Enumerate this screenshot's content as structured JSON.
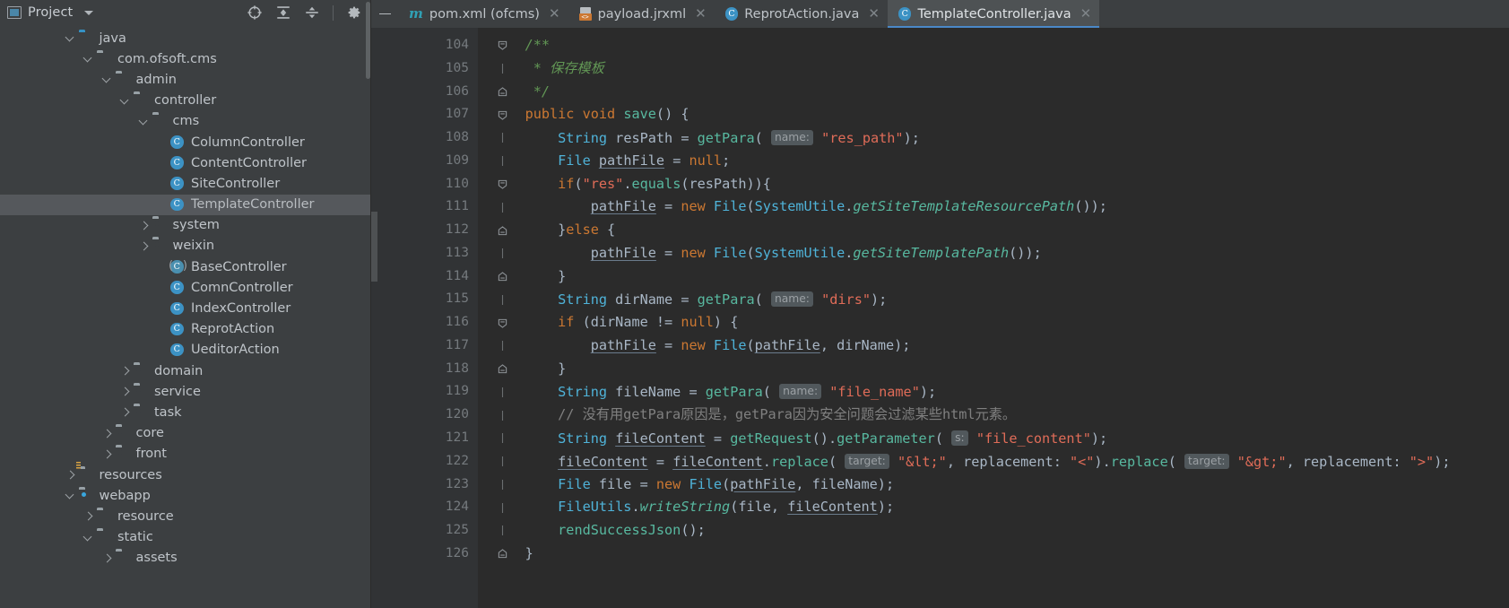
{
  "sidebar": {
    "title": "Project",
    "icons": [
      "project-icon",
      "chevron-down-icon",
      "locate-icon",
      "expand-all-icon",
      "collapse-all-icon",
      "gear-icon"
    ],
    "tree": [
      {
        "label": "java",
        "indent": 3,
        "twisty": "down",
        "icon": "folder-source-blue",
        "selected": false
      },
      {
        "label": "com.ofsoft.cms",
        "indent": 4,
        "twisty": "down",
        "icon": "folder-package",
        "selected": false
      },
      {
        "label": "admin",
        "indent": 5,
        "twisty": "down",
        "icon": "folder-package",
        "selected": false
      },
      {
        "label": "controller",
        "indent": 6,
        "twisty": "down",
        "icon": "folder-package",
        "selected": false
      },
      {
        "label": "cms",
        "indent": 7,
        "twisty": "down",
        "icon": "folder-package",
        "selected": false
      },
      {
        "label": "ColumnController",
        "indent": 8,
        "twisty": "none",
        "icon": "class-icon",
        "selected": false
      },
      {
        "label": "ContentController",
        "indent": 8,
        "twisty": "none",
        "icon": "class-icon",
        "selected": false
      },
      {
        "label": "SiteController",
        "indent": 8,
        "twisty": "none",
        "icon": "class-icon",
        "selected": false
      },
      {
        "label": "TemplateController",
        "indent": 8,
        "twisty": "none",
        "icon": "class-icon",
        "selected": true
      },
      {
        "label": "system",
        "indent": 7,
        "twisty": "right",
        "icon": "folder-package",
        "selected": false
      },
      {
        "label": "weixin",
        "indent": 7,
        "twisty": "right",
        "icon": "folder-package",
        "selected": false
      },
      {
        "label": "BaseController",
        "indent": 8,
        "twisty": "none",
        "icon": "abstract-class-icon",
        "selected": false
      },
      {
        "label": "ComnController",
        "indent": 8,
        "twisty": "none",
        "icon": "class-icon",
        "selected": false
      },
      {
        "label": "IndexController",
        "indent": 8,
        "twisty": "none",
        "icon": "class-icon",
        "selected": false
      },
      {
        "label": "ReprotAction",
        "indent": 8,
        "twisty": "none",
        "icon": "class-icon",
        "selected": false
      },
      {
        "label": "UeditorAction",
        "indent": 8,
        "twisty": "none",
        "icon": "class-icon",
        "selected": false
      },
      {
        "label": "domain",
        "indent": 6,
        "twisty": "right",
        "icon": "folder-package",
        "selected": false
      },
      {
        "label": "service",
        "indent": 6,
        "twisty": "right",
        "icon": "folder-package",
        "selected": false
      },
      {
        "label": "task",
        "indent": 6,
        "twisty": "right",
        "icon": "folder-package",
        "selected": false
      },
      {
        "label": "core",
        "indent": 5,
        "twisty": "right",
        "icon": "folder-package",
        "selected": false
      },
      {
        "label": "front",
        "indent": 5,
        "twisty": "right",
        "icon": "folder-package",
        "selected": false
      },
      {
        "label": "resources",
        "indent": 3,
        "twisty": "right",
        "icon": "folder-resources",
        "selected": false
      },
      {
        "label": "webapp",
        "indent": 3,
        "twisty": "down",
        "icon": "folder-source-web",
        "selected": false
      },
      {
        "label": "resource",
        "indent": 4,
        "twisty": "right",
        "icon": "folder-plain",
        "selected": false
      },
      {
        "label": "static",
        "indent": 4,
        "twisty": "down",
        "icon": "folder-plain",
        "selected": false
      },
      {
        "label": "assets",
        "indent": 5,
        "twisty": "right",
        "icon": "folder-plain",
        "selected": false
      }
    ]
  },
  "tabs": [
    {
      "label": "pom.xml (ofcms)",
      "icon": "maven-icon",
      "active": false,
      "closable": true
    },
    {
      "label": "payload.jrxml",
      "icon": "xml-file-icon",
      "active": false,
      "closable": true
    },
    {
      "label": "ReprotAction.java",
      "icon": "java-class-icon",
      "active": false,
      "closable": true
    },
    {
      "label": "TemplateController.java",
      "icon": "java-class-icon",
      "active": true,
      "closable": true
    }
  ],
  "editor": {
    "first_line": 104,
    "lines": [
      {
        "n": 104,
        "fold": "start",
        "text": "    /**"
      },
      {
        "n": 105,
        "fold": "none",
        "text": "     * 保存模板"
      },
      {
        "n": 106,
        "fold": "end",
        "text": "     */"
      },
      {
        "n": 107,
        "fold": "start",
        "text": "    public void save() {"
      },
      {
        "n": 108,
        "fold": "none",
        "text": "        String resPath = getPara( name: \"res_path\");"
      },
      {
        "n": 109,
        "fold": "none",
        "text": "        File pathFile = null;"
      },
      {
        "n": 110,
        "fold": "start",
        "text": "        if(\"res\".equals(resPath)){"
      },
      {
        "n": 111,
        "fold": "none",
        "text": "            pathFile = new File(SystemUtile.getSiteTemplateResourcePath());"
      },
      {
        "n": 112,
        "fold": "end",
        "text": "        }else {"
      },
      {
        "n": 113,
        "fold": "none",
        "text": "            pathFile = new File(SystemUtile.getSiteTemplatePath());"
      },
      {
        "n": 114,
        "fold": "end",
        "text": "        }"
      },
      {
        "n": 115,
        "fold": "none",
        "text": "        String dirName = getPara( name: \"dirs\");"
      },
      {
        "n": 116,
        "fold": "start",
        "text": "        if (dirName != null) {"
      },
      {
        "n": 117,
        "fold": "none",
        "text": "            pathFile = new File(pathFile, dirName);"
      },
      {
        "n": 118,
        "fold": "end",
        "text": "        }"
      },
      {
        "n": 119,
        "fold": "none",
        "text": "        String fileName = getPara( name: \"file_name\");"
      },
      {
        "n": 120,
        "fold": "none",
        "text": "        // 没有用getPara原因是，getPara因为安全问题会过滤某些html元素。"
      },
      {
        "n": 121,
        "fold": "none",
        "text": "        String fileContent = getRequest().getParameter( s: \"file_content\");"
      },
      {
        "n": 122,
        "fold": "none",
        "text": "        fileContent = fileContent.replace( target: \"&lt;\", replacement: \"<\").replace( target: \"&gt;\", replacement: \">\");"
      },
      {
        "n": 123,
        "fold": "none",
        "text": "        File file = new File(pathFile, fileName);"
      },
      {
        "n": 124,
        "fold": "none",
        "text": "        FileUtils.writeString(file, fileContent);"
      },
      {
        "n": 125,
        "fold": "none",
        "text": "        rendSuccessJson();"
      },
      {
        "n": 126,
        "fold": "end",
        "text": "    }"
      }
    ]
  },
  "colors": {
    "panel_bg": "#3c3f41",
    "editor_bg": "#2b2b2b",
    "gutter_bg": "#313335",
    "selection": "#55585c",
    "accent": "#4a88c7",
    "keyword": "#cc7832",
    "string": "#e06c58",
    "comment": "#808080",
    "javadoc": "#629755",
    "type": "#4fb3d9",
    "method": "#58b9a0"
  }
}
